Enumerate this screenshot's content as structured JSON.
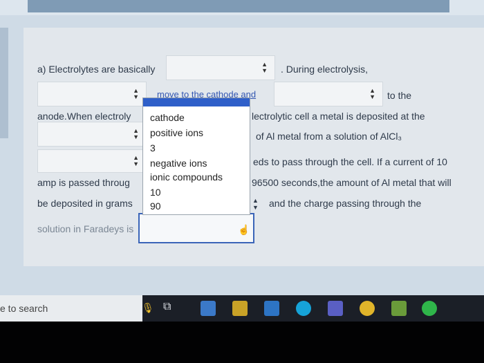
{
  "question": {
    "line1_a": "a) Electrolytes are basically",
    "line1_b": ". During electrolysis,",
    "line2_a": "move to the cathode and",
    "line2_b": "to the",
    "line3_a": "anode.When electroly",
    "line3_b": "lectrolytic cell a metal is deposited at the",
    "line4_b": "of Al metal from a solution of AlCl₃",
    "line5_b": "eds to pass through the cell. If a current of 10",
    "line6_a": "amp is passed throug",
    "line6_b": "96500 seconds,the amount of Al metal that will",
    "line7_a": "be deposited in grams",
    "line7_b": "and the charge passing through the",
    "line8_a": "solution in Faradeys is"
  },
  "dropdown": {
    "options": [
      "cathode",
      "positive ions",
      "3",
      "negative ions",
      "ionic compounds",
      "10",
      "90"
    ]
  },
  "taskbar": {
    "search_text": "e to search"
  },
  "colors": {
    "accent": "#2f5fc9",
    "page_bg": "#e2e7ec",
    "taskbar": "#1b1f27"
  }
}
